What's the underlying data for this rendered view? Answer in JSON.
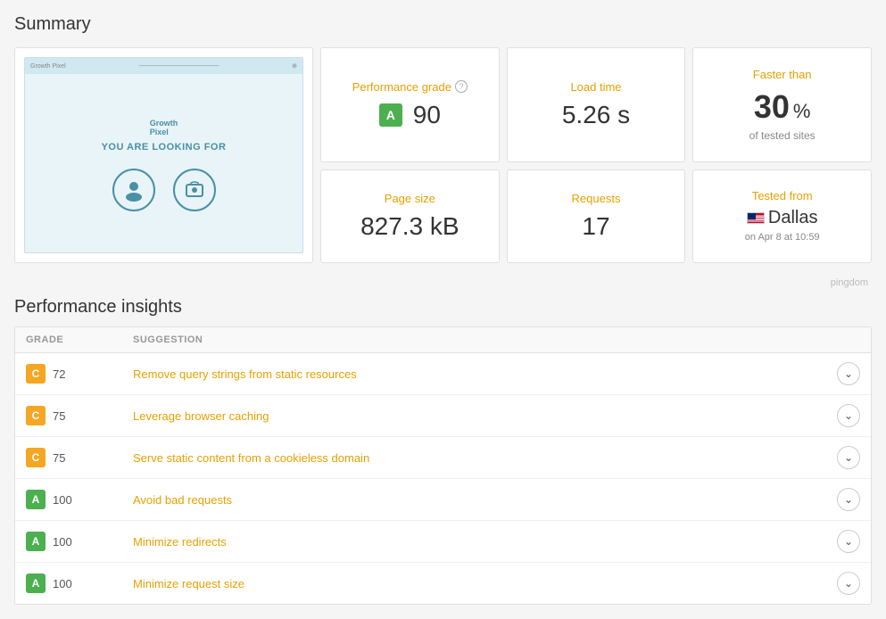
{
  "page": {
    "summary_title": "Summary",
    "insights_title": "Performance insights",
    "pingdom_credit": "pingdom"
  },
  "summary": {
    "performance_grade": {
      "label": "Performance grade",
      "help_icon": "?",
      "grade_letter": "A",
      "grade_value": "90"
    },
    "load_time": {
      "label": "Load time",
      "value": "5.26 s"
    },
    "faster_than": {
      "label": "Faster than",
      "percent": "30",
      "percent_sign": "%",
      "sub_label": "of tested sites"
    },
    "page_size": {
      "label": "Page size",
      "value": "827.3 kB"
    },
    "requests": {
      "label": "Requests",
      "value": "17"
    },
    "tested_from": {
      "label": "Tested from",
      "city": "Dallas",
      "date": "on Apr 8 at 10:59"
    }
  },
  "insights": {
    "headers": {
      "grade": "GRADE",
      "suggestion": "SUGGESTION"
    },
    "rows": [
      {
        "grade_letter": "C",
        "grade_class": "grade-c",
        "score": "72",
        "suggestion": "Remove query strings from static resources"
      },
      {
        "grade_letter": "C",
        "grade_class": "grade-c",
        "score": "75",
        "suggestion": "Leverage browser caching"
      },
      {
        "grade_letter": "C",
        "grade_class": "grade-c",
        "score": "75",
        "suggestion": "Serve static content from a cookieless domain"
      },
      {
        "grade_letter": "A",
        "grade_class": "grade-a",
        "score": "100",
        "suggestion": "Avoid bad requests"
      },
      {
        "grade_letter": "A",
        "grade_class": "grade-a",
        "score": "100",
        "suggestion": "Minimize redirects"
      },
      {
        "grade_letter": "A",
        "grade_class": "grade-a",
        "score": "100",
        "suggestion": "Minimize request size"
      }
    ]
  }
}
